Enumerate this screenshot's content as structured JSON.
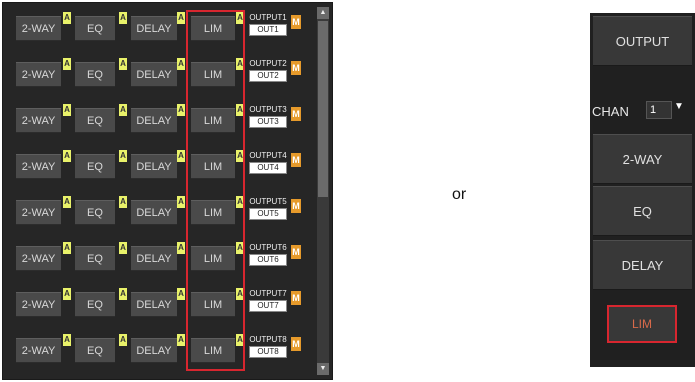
{
  "panel": {
    "labels": {
      "two_way": "2-WAY",
      "eq": "EQ",
      "delay": "DELAY",
      "lim": "LIM",
      "a": "A",
      "m": "M"
    },
    "rows": [
      {
        "output": "OUTPUT1",
        "out": "OUT1"
      },
      {
        "output": "OUTPUT2",
        "out": "OUT2"
      },
      {
        "output": "OUTPUT3",
        "out": "OUT3"
      },
      {
        "output": "OUTPUT4",
        "out": "OUT4"
      },
      {
        "output": "OUTPUT5",
        "out": "OUT5"
      },
      {
        "output": "OUTPUT6",
        "out": "OUT6"
      },
      {
        "output": "OUTPUT7",
        "out": "OUT7"
      },
      {
        "output": "OUTPUT8",
        "out": "OUT8"
      }
    ],
    "scroll_up_icon": "triangle-up",
    "scroll_down_icon": "triangle-down"
  },
  "separator": {
    "text": "or"
  },
  "vertical_panel": {
    "output_label": "OUTPUT",
    "chan_label": "CHAN",
    "chan_value": "1",
    "two_way_label": "2-WAY",
    "eq_label": "EQ",
    "delay_label": "DELAY",
    "lim_label": "LIM"
  },
  "colors": {
    "highlight": "#d8262f",
    "a_tag": "#e9f26a",
    "m_tag": "#e69a2b"
  }
}
